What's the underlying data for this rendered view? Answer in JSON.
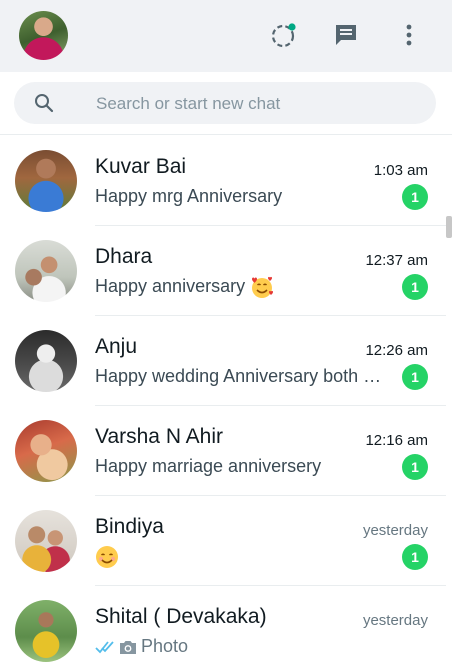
{
  "header": {
    "profile_icon": "user-avatar",
    "status_icon": "status-ring-icon",
    "new_chat_icon": "chat-bubble-icon",
    "menu_icon": "kebab-menu-icon",
    "status_dot_color": "#00a884"
  },
  "search": {
    "placeholder": "Search or start new chat",
    "value": ""
  },
  "colors": {
    "unread_badge": "#25d366",
    "read_ticks": "#53bdeb"
  },
  "chats": [
    {
      "name": "Kuvar Bai",
      "time": "1:03 am",
      "message": "Happy mrg Anniversary",
      "unread": "1"
    },
    {
      "name": "Dhara",
      "time": "12:37 am",
      "message": "Happy anniversary",
      "emoji": "smiling-face-with-hearts",
      "unread": "1"
    },
    {
      "name": "Anju",
      "time": "12:26 am",
      "message": "Happy wedding Anniversary both of you",
      "unread": "1"
    },
    {
      "name": "Varsha N Ahir",
      "time": "12:16 am",
      "message": "Happy marriage anniversery",
      "unread": "1"
    },
    {
      "name": "Bindiya",
      "time": "yesterday",
      "emoji": "smiling-face",
      "unread": "1"
    },
    {
      "name": "Shital ( Devakaka)",
      "time": "yesterday",
      "message": "Photo",
      "status": "read-double-tick",
      "media": "camera-icon"
    }
  ]
}
